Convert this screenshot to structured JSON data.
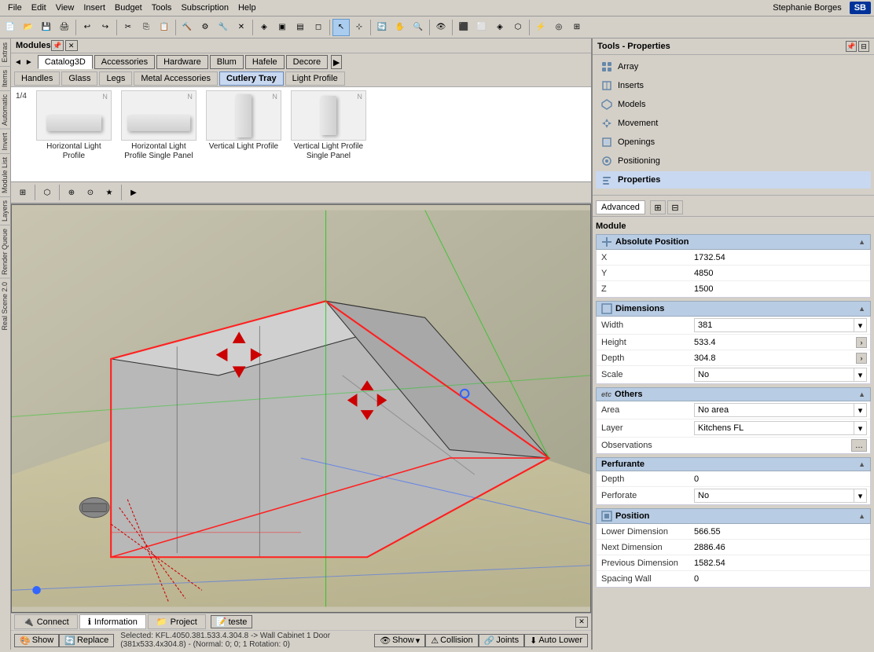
{
  "app": {
    "title": "Modules",
    "right_panel_title": "Tools - Properties"
  },
  "user": {
    "name": "Stephanie Borges",
    "initials": "SB"
  },
  "menubar": {
    "items": [
      "File",
      "Edit",
      "View",
      "Insert",
      "Budget",
      "Tools",
      "Subscription",
      "Help"
    ]
  },
  "catalog": {
    "tabs": [
      "Catalog3D",
      "Accessories",
      "Hardware",
      "Blum",
      "Hafele",
      "Decore"
    ],
    "active": "Catalog3D"
  },
  "categories": {
    "tabs": [
      "Handles",
      "Glass",
      "Legs",
      "Metal Accessories",
      "Cutlery Tray",
      "Light Profile"
    ],
    "active": "Cutlery Tray"
  },
  "items": {
    "pagination": "1/4",
    "list": [
      {
        "label": "Horizontal Light Profile",
        "type": "horiz"
      },
      {
        "label": "Horizontal Light Profile Single Panel",
        "type": "horiz"
      },
      {
        "label": "Vertical Light Profile",
        "type": "vert"
      },
      {
        "label": "Vertical Light Profile Single Panel",
        "type": "vert"
      }
    ]
  },
  "right_tools": {
    "items": [
      {
        "label": "Array",
        "icon": "grid"
      },
      {
        "label": "Inserts",
        "icon": "insert"
      },
      {
        "label": "Models",
        "icon": "model"
      },
      {
        "label": "Movement",
        "icon": "move"
      },
      {
        "label": "Openings",
        "icon": "open"
      },
      {
        "label": "Positioning",
        "icon": "pos"
      },
      {
        "label": "Properties",
        "icon": "prop",
        "active": true
      }
    ]
  },
  "props": {
    "module_label": "Module",
    "tabs": [
      "Advanced"
    ],
    "sections": {
      "absolute_position": {
        "title": "Absolute Position",
        "fields": [
          {
            "key": "X",
            "value": "1732.54"
          },
          {
            "key": "Y",
            "value": "4850"
          },
          {
            "key": "Z",
            "value": "1500"
          }
        ]
      },
      "dimensions": {
        "title": "Dimensions",
        "fields": [
          {
            "key": "Width",
            "value": "381",
            "has_dropdown": true
          },
          {
            "key": "Height",
            "value": "533.4",
            "has_btn": true
          },
          {
            "key": "Depth",
            "value": "304.8",
            "has_btn": true
          },
          {
            "key": "Scale",
            "value": "No",
            "has_dropdown": true
          }
        ]
      },
      "others": {
        "title": "Others",
        "prefix": "etc",
        "fields": [
          {
            "key": "Area",
            "value": "No area",
            "has_dropdown": true
          },
          {
            "key": "Layer",
            "value": "Kitchens FL",
            "has_dropdown": true
          },
          {
            "key": "Observations",
            "value": "",
            "has_obs_btn": true
          }
        ]
      },
      "perfurante": {
        "title": "Perfurante",
        "fields": [
          {
            "key": "Depth",
            "value": "0"
          },
          {
            "key": "Perforate",
            "value": "No",
            "has_dropdown": true
          }
        ]
      },
      "position": {
        "title": "Position",
        "fields": [
          {
            "key": "Lower Dimension",
            "value": "566.55"
          },
          {
            "key": "Next Dimension",
            "value": "2886.46"
          },
          {
            "key": "Previous Dimension",
            "value": "1582.54"
          },
          {
            "key": "Spacing Wall",
            "value": "0"
          }
        ]
      }
    }
  },
  "status_bar": {
    "selected_text": "Selected: KFL.4050.381.533.4.304.8 -> Wall Cabinet 1 Door (381x533.4x304.8) - (Normal: 0; 0; 1 Rotation: 0)"
  },
  "bottom_tabs": {
    "tabs": [
      "Connect",
      "Information",
      "Project"
    ],
    "active": "Information",
    "field_label": "teste"
  },
  "bottom_actions": {
    "show": "Show",
    "collision": "Collision",
    "joints": "Joints",
    "auto_lower": "Auto Lower"
  }
}
